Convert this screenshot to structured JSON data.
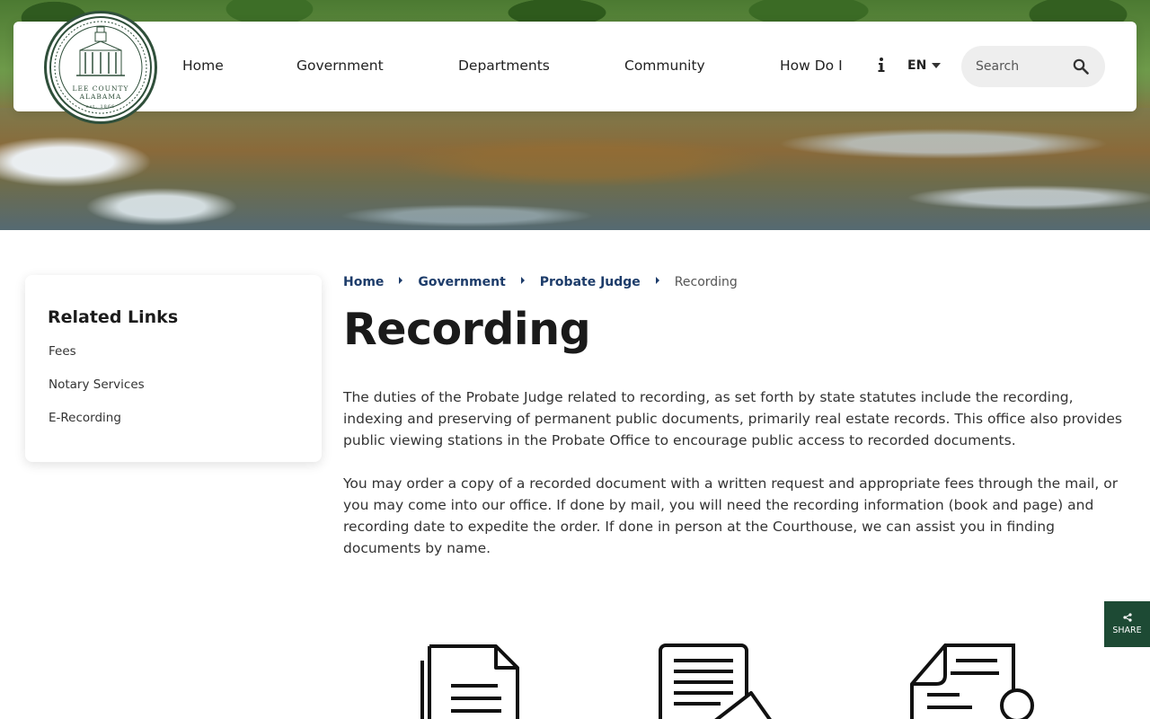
{
  "header": {
    "logo": {
      "line1": "LEE COUNTY",
      "line2": "ALABAMA",
      "line3": "est. 1866"
    },
    "nav": [
      {
        "label": "Home"
      },
      {
        "label": "Government"
      },
      {
        "label": "Departments"
      },
      {
        "label": "Community"
      },
      {
        "label": "How Do I"
      }
    ],
    "language": "EN",
    "search": {
      "placeholder": "Search"
    }
  },
  "sidebar": {
    "title": "Related Links",
    "links": [
      {
        "label": "Fees"
      },
      {
        "label": "Notary Services"
      },
      {
        "label": "E-Recording"
      }
    ]
  },
  "breadcrumb": {
    "items": [
      {
        "label": "Home"
      },
      {
        "label": "Government"
      },
      {
        "label": "Probate Judge"
      }
    ],
    "current": "Recording"
  },
  "main": {
    "title": "Recording",
    "paragraphs": [
      "The duties of the Probate Judge related to recording, as set forth by state statutes include the recording, indexing and preserving of permanent public documents, primarily real estate records. This office also provides public viewing stations in the Probate Office to encourage public access to recorded documents.",
      "You may order a copy of a recorded document with a written request and appropriate fees through the mail, or you may come into our office.  If done by mail, you will need the recording information (book and page) and recording date to expedite the order. If done in person at the Courthouse, we can assist you in finding documents by name."
    ]
  },
  "share": {
    "label": "SHARE"
  },
  "colors": {
    "brand_green": "#1d4a34",
    "link_blue": "#1d3c6a"
  }
}
